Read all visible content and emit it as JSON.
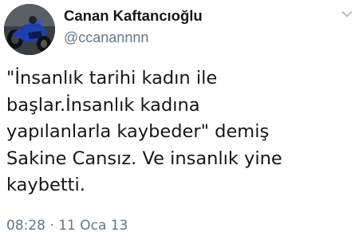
{
  "user": {
    "display_name": "Canan Kaftancıoğlu",
    "handle": "@ccanannnn",
    "avatar_icon": "motorcycle-avatar-icon"
  },
  "menu": {
    "icon": "chevron-down-icon"
  },
  "tweet": {
    "lines": [
      "\"İnsanlık tarihi kadın ile",
      "başlar.İnsanlık kadına",
      "yapılanlarla kaybeder\" demiş",
      "Sakine Cansız. Ve insanlık yine",
      "kaybetti."
    ],
    "time": "08:28",
    "separator": "·",
    "date": "11 Oca 13"
  },
  "colors": {
    "text_primary": "#14171a",
    "text_secondary": "#657786",
    "background": "#ffffff"
  }
}
